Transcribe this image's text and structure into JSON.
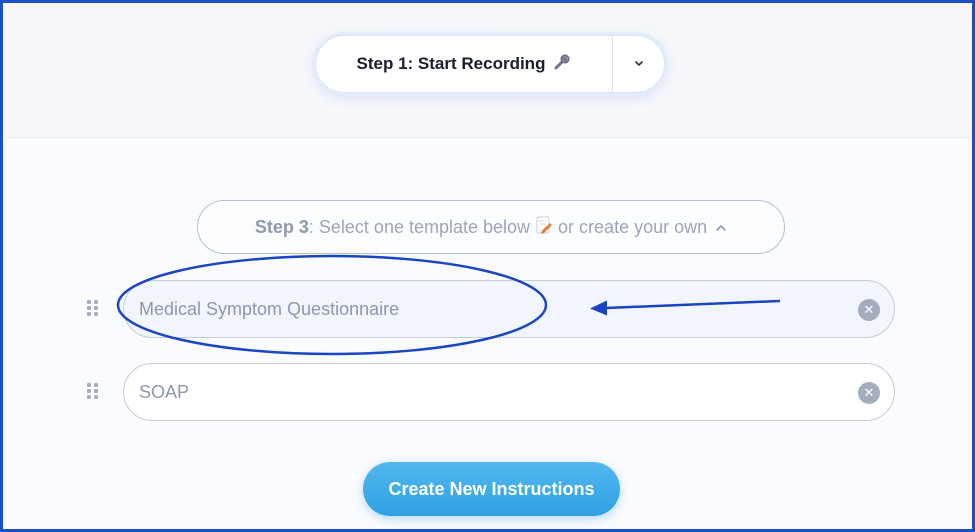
{
  "recorder": {
    "start_label": "Step 1: Start Recording",
    "mic_icon": "microphone-icon",
    "toggle_icon": "chevron-down-icon",
    "toggle_glyph": "⌄"
  },
  "template_picker": {
    "step_prefix": "Step 3",
    "step_text": ": Select one template below",
    "memo_icon": "memo-icon",
    "step_suffix": "or create your own",
    "caret_icon": "chevron-up-icon",
    "caret_glyph": "^"
  },
  "templates": [
    {
      "name": "Medical Symptom Questionnaire",
      "selected": true
    },
    {
      "name": "SOAP",
      "selected": false
    }
  ],
  "actions": {
    "create_label": "Create New Instructions"
  },
  "colors": {
    "frame_border": "#1d4fc4",
    "annotation": "#1a44c2",
    "create_button": "#3aa9e8"
  }
}
